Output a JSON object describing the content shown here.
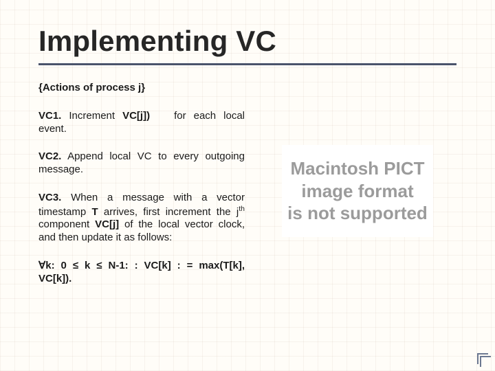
{
  "title": "Implementing VC",
  "subtitle": "{Actions of process j}",
  "items": {
    "vc1": {
      "label": "VC1.",
      "prefix": " Increment ",
      "code": "VC[j])",
      "suffix": " for each local event."
    },
    "vc2": {
      "label": "VC2.",
      "text": " Append local VC to every outgoing message."
    },
    "vc3": {
      "label": "VC3.",
      "part1": " When a message with a vector timestamp ",
      "t": "T",
      "part2": " arrives, first increment the j",
      "th": "th",
      "part3": " component ",
      "code": "VC[j]",
      "part4": " of the local vector clock, and then update it as follows:"
    },
    "formula": "∀k: 0 ≤ k ≤ N-1: : VC[k] : = max(T[k], VC[k])."
  },
  "pict": {
    "l1": "Macintosh PICT",
    "l2": "image format",
    "l3": "is not supported"
  }
}
